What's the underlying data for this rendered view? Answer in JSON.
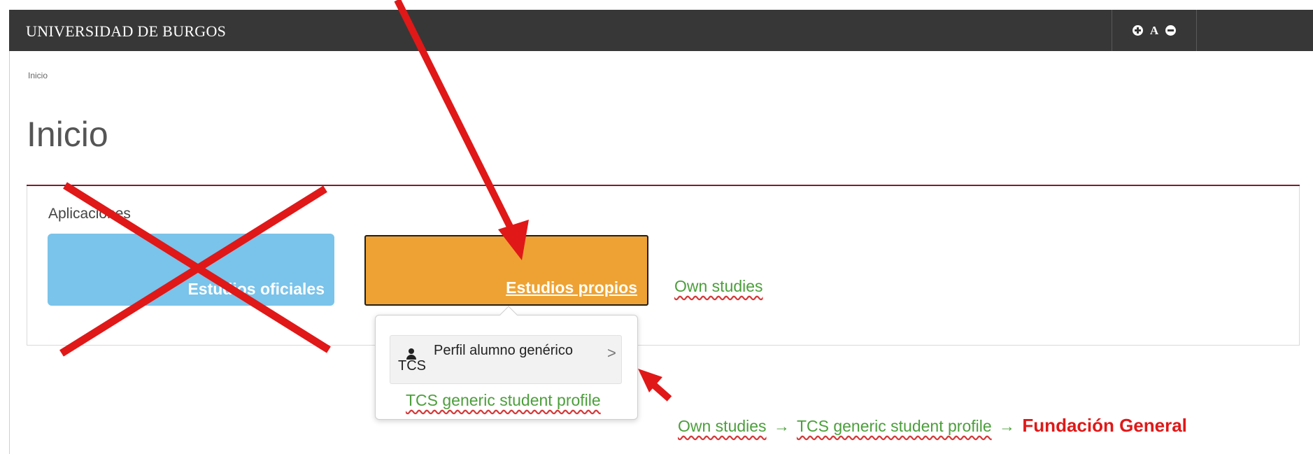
{
  "header": {
    "university_name": "UNIVERSIDAD DE BURGOS",
    "font_increase_icon": "plus-circle-icon",
    "font_label": "A",
    "font_decrease_icon": "minus-circle-icon"
  },
  "breadcrumb": {
    "home": "Inicio"
  },
  "page": {
    "title": "Inicio"
  },
  "applications": {
    "label": "Aplicaciones",
    "tiles": [
      {
        "label": "Estudios oficiales",
        "color": "#7ac3ea"
      },
      {
        "label": "Estudios propios",
        "color": "#eea233"
      }
    ]
  },
  "popover": {
    "item_line1": "Perfil alumno genérico",
    "item_line2": "TCS",
    "item_icon": "user-icon",
    "chevron": ">"
  },
  "annotations": {
    "own_studies": "Own studies",
    "profile_translation": "TCS generic student profile",
    "path_step1": "Own studies",
    "path_arrow": "→",
    "path_step2": "TCS generic student profile",
    "path_step3": "Fundación General",
    "annotation_color": "#e01818",
    "note_color": "#4c9f3c"
  },
  "theme": {
    "topbar": "#373737",
    "title_rule": "#7b1e2c"
  }
}
